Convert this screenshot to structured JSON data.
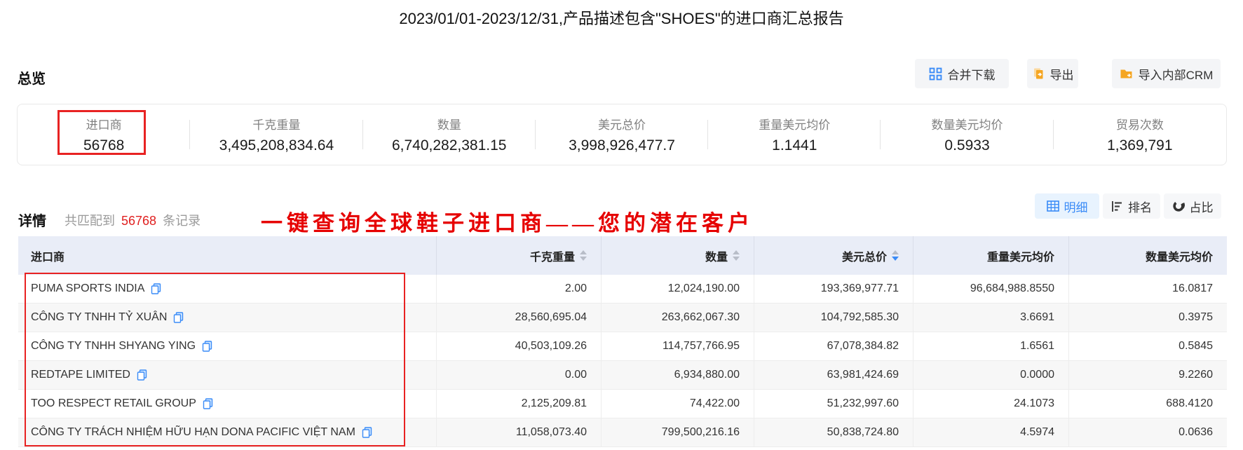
{
  "page_title": "2023/01/01-2023/12/31,产品描述包含\"SHOES\"的进口商汇总报告",
  "overview": {
    "heading": "总览",
    "buttons": {
      "merge_download": "合并下载",
      "export": "导出",
      "import_crm": "导入内部CRM"
    },
    "stats": [
      {
        "label": "进口商",
        "value": "56768",
        "highlighted": true
      },
      {
        "label": "千克重量",
        "value": "3,495,208,834.64"
      },
      {
        "label": "数量",
        "value": "6,740,282,381.15"
      },
      {
        "label": "美元总价",
        "value": "3,998,926,477.7"
      },
      {
        "label": "重量美元均价",
        "value": "1.1441"
      },
      {
        "label": "数量美元均价",
        "value": "0.5933"
      },
      {
        "label": "贸易次数",
        "value": "1,369,791"
      }
    ]
  },
  "detail": {
    "heading": "详情",
    "match_prefix": "共匹配到",
    "match_count": "56768",
    "match_suffix": "条记录",
    "annotation": "一键查询全球鞋子进口商——您的潜在客户",
    "view_tabs": [
      {
        "label": "明细",
        "active": true
      },
      {
        "label": "排名",
        "active": false
      },
      {
        "label": "占比",
        "active": false
      }
    ]
  },
  "table": {
    "headers": [
      {
        "label": "进口商",
        "sortable": false
      },
      {
        "label": "千克重量",
        "sortable": true,
        "sorted": "none"
      },
      {
        "label": "数量",
        "sortable": true,
        "sorted": "none"
      },
      {
        "label": "美元总价",
        "sortable": true,
        "sorted": "desc"
      },
      {
        "label": "重量美元均价",
        "sortable": false
      },
      {
        "label": "数量美元均价",
        "sortable": false
      }
    ],
    "rows": [
      [
        "PUMA SPORTS INDIA",
        "2.00",
        "12,024,190.00",
        "193,369,977.71",
        "96,684,988.8550",
        "16.0817"
      ],
      [
        "CÔNG TY TNHH TỶ XUÂN",
        "28,560,695.04",
        "263,662,067.30",
        "104,792,585.30",
        "3.6691",
        "0.3975"
      ],
      [
        "CÔNG TY TNHH SHYANG YING",
        "40,503,109.26",
        "114,757,766.95",
        "67,078,384.82",
        "1.6561",
        "0.5845"
      ],
      [
        "REDTAPE LIMITED",
        "0.00",
        "6,934,880.00",
        "63,981,424.69",
        "0.0000",
        "9.2260"
      ],
      [
        "TOO RESPECT RETAIL GROUP",
        "2,125,209.81",
        "74,422.00",
        "51,232,997.60",
        "24.1073",
        "688.4120"
      ],
      [
        "CÔNG TY TRÁCH NHIỆM HỮU HẠN DONA PACIFIC VIỆT NAM",
        "11,058,073.40",
        "799,500,216.16",
        "50,838,724.80",
        "4.5974",
        "0.0636"
      ]
    ]
  },
  "colors": {
    "accent_blue": "#3a8bf7",
    "highlight_red": "#e82222",
    "annotation_red": "#e60000",
    "icon_orange": "#f5a623",
    "header_bg": "#e9edf7"
  }
}
